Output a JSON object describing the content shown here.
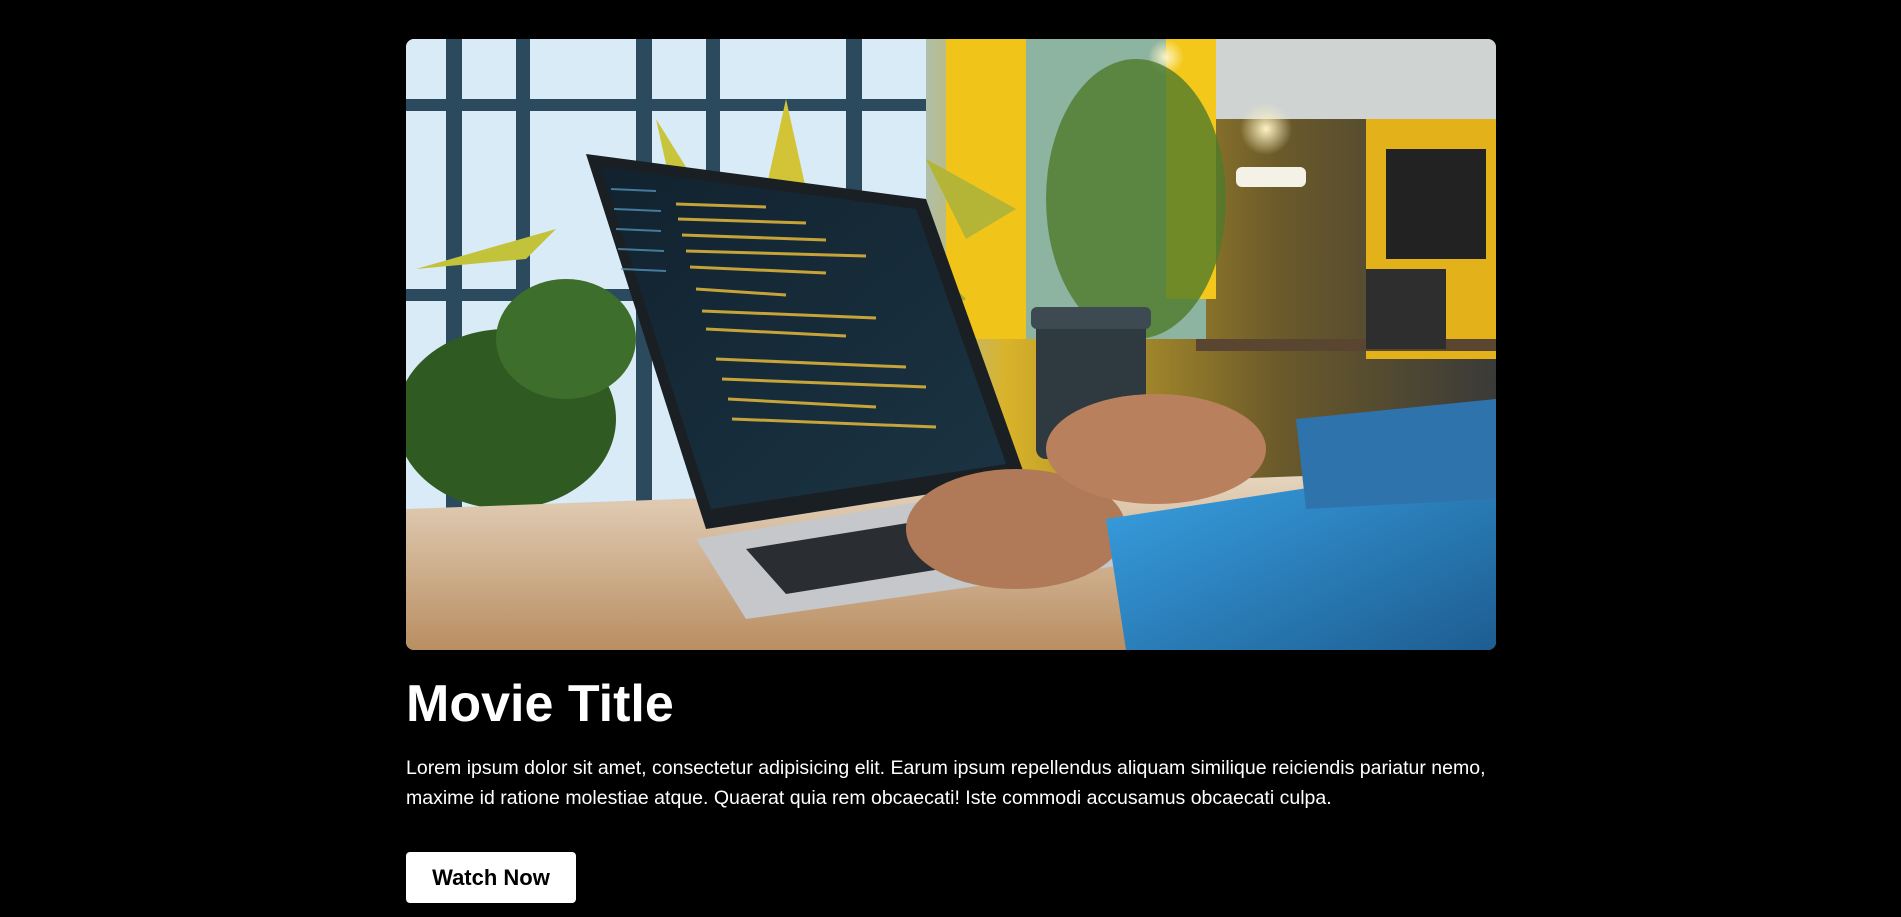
{
  "hero": {
    "image_alt": "Person typing code on a laptop in a cafe with plants",
    "palette": {
      "window_light": "#e8f2fb",
      "wall_yellow": "#f2c70f",
      "screen_dark": "#0f1e2b",
      "code_yellow": "#e6b93a",
      "plant_green": "#5f8a2a",
      "denim_blue": "#2f8fd0",
      "skin": "#b9805e",
      "table_wood": "#c9a27a"
    }
  },
  "content": {
    "title": "Movie Title",
    "description": "Lorem ipsum dolor sit amet, consectetur adipisicing elit. Earum ipsum repellendus aliquam similique reiciendis pariatur nemo, maxime id ratione molestiae atque. Quaerat quia rem obcaecati! Iste commodi accusamus obcaecati culpa.",
    "cta_label": "Watch Now"
  },
  "colors": {
    "background": "#000000",
    "text": "#ffffff",
    "button_bg": "#ffffff",
    "button_text": "#000000"
  }
}
